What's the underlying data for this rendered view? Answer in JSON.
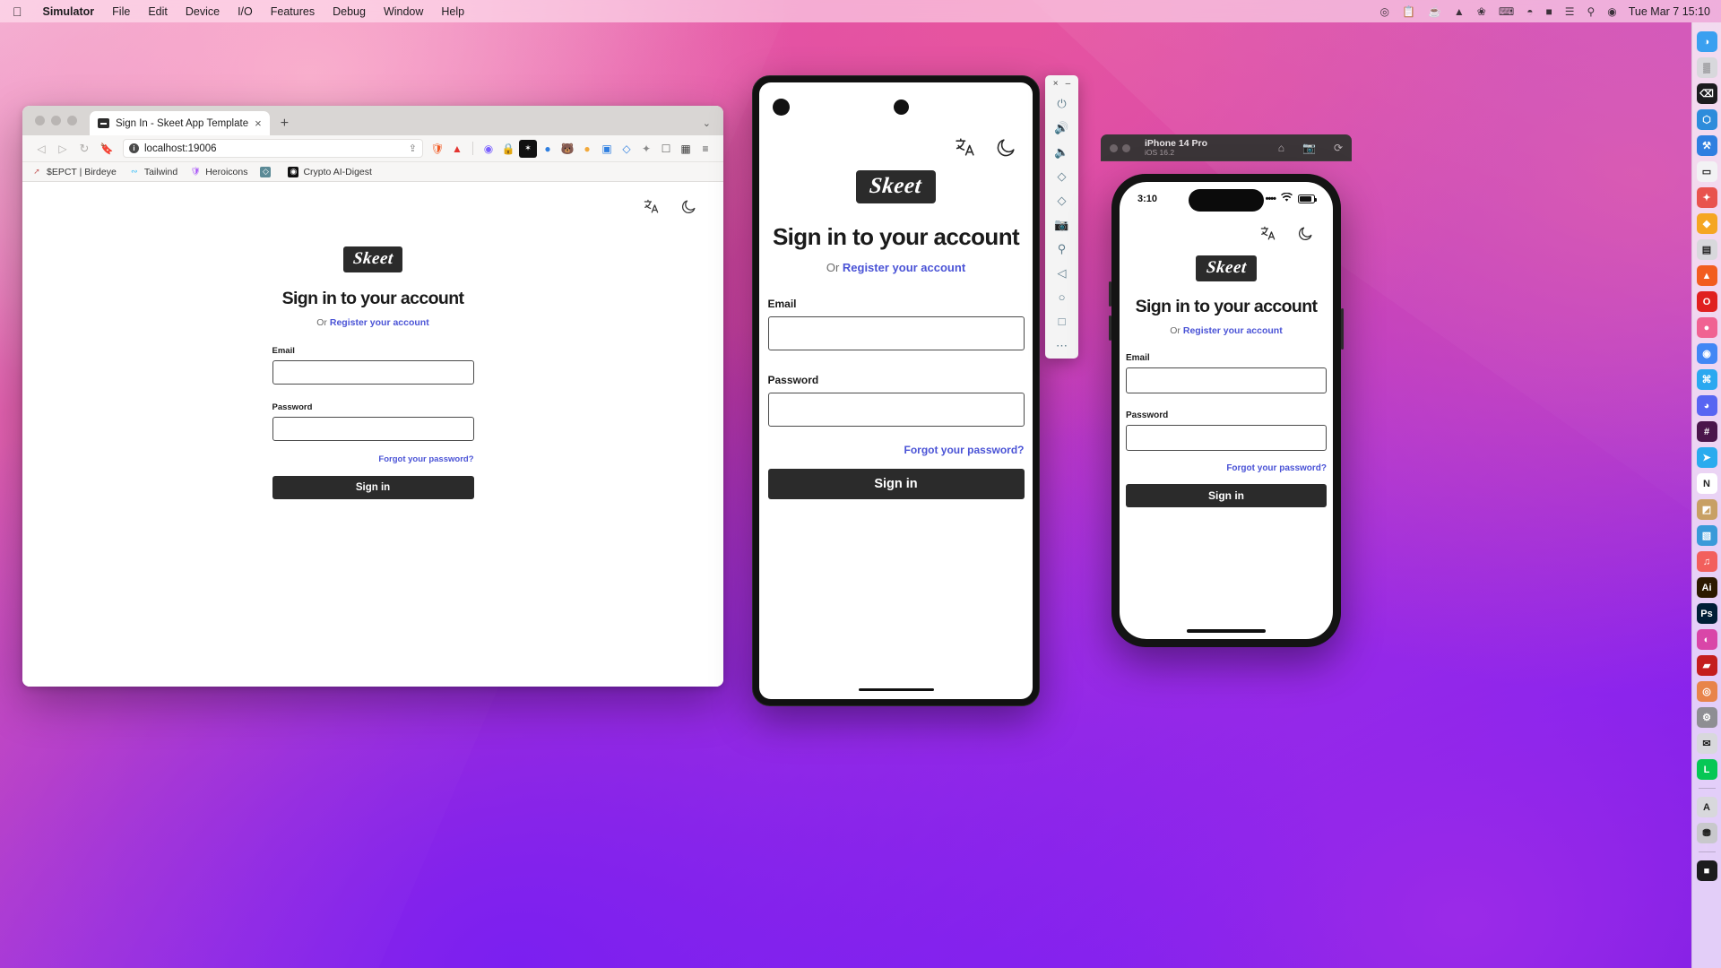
{
  "menubar": {
    "apple_icon": "apple-logo",
    "items": [
      {
        "label": "Simulator",
        "bold": true
      },
      {
        "label": "File",
        "bold": false
      },
      {
        "label": "Edit",
        "bold": false
      },
      {
        "label": "Device",
        "bold": false
      },
      {
        "label": "I/O",
        "bold": false
      },
      {
        "label": "Features",
        "bold": false
      },
      {
        "label": "Debug",
        "bold": false
      },
      {
        "label": "Window",
        "bold": false
      },
      {
        "label": "Help",
        "bold": false
      }
    ],
    "status_icons": [
      "raycast-icon",
      "clipboard-icon",
      "cup-icon",
      "stats-icon",
      "bluetooth-icon",
      "keyboard-icon",
      "wifi-icon",
      "battery-icon",
      "control-center-icon",
      "search-icon",
      "siri-icon"
    ],
    "clock": "Tue Mar 7  15:10"
  },
  "browser": {
    "tab": {
      "title": "Sign In - Skeet App Template",
      "close_label": "×",
      "favicon": "skeet-favicon"
    },
    "new_tab_label": "+",
    "window_chevron": "⌄",
    "nav": {
      "back": "◁",
      "forward": "▷",
      "reload": "↻"
    },
    "bookmark_icon": "bookmark-icon",
    "url": "localhost:19006",
    "url_security_icon": "info-circle-icon",
    "share_icon": "share-icon",
    "toolbar_icons": [
      "brave-shield-icon",
      "adobe-icon",
      "spacer",
      "discord-icon",
      "metamask-lock-icon",
      "phantom-icon",
      "rabby-icon",
      "foxwallet-icon",
      "tally-icon",
      "translate-icon",
      "sketch-icon",
      "extensions-icon",
      "sidebar-icon",
      "wallet-icon",
      "menu-icon"
    ],
    "bookmarks": [
      {
        "label": "$EPCT | Birdeye",
        "icon": "rocket-icon",
        "color": "#c86464"
      },
      {
        "label": "Tailwind",
        "icon": "tailwind-icon",
        "color": "#38bdf8"
      },
      {
        "label": "Heroicons",
        "icon": "heroicons-icon",
        "color": "#a855f7"
      },
      {
        "label": "",
        "icon": "gem-icon",
        "color": "#5b8a96"
      },
      {
        "label": "Crypto AI-Digest",
        "icon": "crypto-icon",
        "color": "#1a1a1a"
      }
    ]
  },
  "app": {
    "logo_text": "Skeet",
    "heading": "Sign in to your account",
    "sub_prefix": "Or ",
    "sub_link": "Register your account",
    "fields": [
      {
        "label": "Email",
        "value": "",
        "name": "email"
      },
      {
        "label": "Password",
        "value": "",
        "name": "password"
      }
    ],
    "forgot_link": "Forgot your password?",
    "submit_label": "Sign in",
    "topbar_icons": [
      {
        "name": "language-icon",
        "glyph": "文A"
      },
      {
        "name": "dark-mode-moon-icon",
        "glyph": "☾"
      }
    ],
    "colors": {
      "link": "#4a53d6",
      "button_bg": "#2b2b2b",
      "logo_bg": "#2b2b2b"
    }
  },
  "android": {
    "window_close": "×",
    "window_minimize": "–",
    "tools": [
      {
        "name": "power-icon",
        "glyph": "⏻"
      },
      {
        "name": "volume-up-icon",
        "glyph": "🔊"
      },
      {
        "name": "volume-down-icon",
        "glyph": "🔉"
      },
      {
        "name": "rotate-left-icon",
        "glyph": "◧"
      },
      {
        "name": "rotate-right-icon",
        "glyph": "◨"
      },
      {
        "name": "screenshot-camera-icon",
        "glyph": "▣"
      },
      {
        "name": "zoom-icon",
        "glyph": "⌕"
      },
      {
        "name": "back-nav-icon",
        "glyph": "◁"
      },
      {
        "name": "home-nav-icon",
        "glyph": "○"
      },
      {
        "name": "recents-nav-icon",
        "glyph": "□"
      },
      {
        "name": "more-options-icon",
        "glyph": "⋯"
      }
    ]
  },
  "ios": {
    "device_name": "iPhone 14 Pro",
    "os_version": "iOS 16.2",
    "titlebar_icons": [
      {
        "name": "home-button-icon",
        "glyph": "⌂"
      },
      {
        "name": "screenshot-icon",
        "glyph": "□"
      },
      {
        "name": "rotate-icon",
        "glyph": "↻"
      }
    ],
    "status": {
      "time": "3:10",
      "cellular": "••••",
      "wifi_icon": "wifi-icon",
      "battery_icon": "battery-icon"
    }
  },
  "dock": {
    "items": [
      {
        "name": "finder",
        "bg": "#3aa0f0",
        "glyph": "◑"
      },
      {
        "name": "launchpad",
        "bg": "#d8d8dc",
        "glyph": "▒"
      },
      {
        "name": "terminal",
        "bg": "#1c1c1e",
        "glyph": "⌫"
      },
      {
        "name": "vscode",
        "bg": "#2d8cdb",
        "glyph": "⬡"
      },
      {
        "name": "xcode",
        "bg": "#2f7fe0",
        "glyph": "⚒"
      },
      {
        "name": "simulator",
        "bg": "#f2f2f4",
        "glyph": "▭"
      },
      {
        "name": "figma",
        "bg": "#e8534e",
        "glyph": "✦"
      },
      {
        "name": "sketch",
        "bg": "#f5a623",
        "glyph": "◆"
      },
      {
        "name": "notion-alt",
        "bg": "#d8d8dc",
        "glyph": "▤"
      },
      {
        "name": "brave",
        "bg": "#f25c1f",
        "glyph": "▲"
      },
      {
        "name": "opera",
        "bg": "#e02020",
        "glyph": "O"
      },
      {
        "name": "arc",
        "bg": "#f06292",
        "glyph": "●"
      },
      {
        "name": "chrome",
        "bg": "#4287f5",
        "glyph": "◉"
      },
      {
        "name": "safari",
        "bg": "#2ba8f0",
        "glyph": "⌘"
      },
      {
        "name": "discord",
        "bg": "#5865f2",
        "glyph": "◕"
      },
      {
        "name": "slack",
        "bg": "#4a154b",
        "glyph": "#"
      },
      {
        "name": "telegram",
        "bg": "#2aabee",
        "glyph": "➤"
      },
      {
        "name": "notion",
        "bg": "#ffffff",
        "glyph": "N"
      },
      {
        "name": "bear",
        "bg": "#c8a064",
        "glyph": "◩"
      },
      {
        "name": "preview",
        "bg": "#3a9ad9",
        "glyph": "▧"
      },
      {
        "name": "music",
        "bg": "#f25f5c",
        "glyph": "♫"
      },
      {
        "name": "illustrator",
        "bg": "#2d1a00",
        "glyph": "Ai"
      },
      {
        "name": "photoshop",
        "bg": "#001e36",
        "glyph": "Ps"
      },
      {
        "name": "lightroom",
        "bg": "#d946a8",
        "glyph": "◐"
      },
      {
        "name": "acrobat",
        "bg": "#c41e1e",
        "glyph": "▰"
      },
      {
        "name": "chatgpt",
        "bg": "#e8844a",
        "glyph": "◎"
      },
      {
        "name": "settings",
        "bg": "#8e8e93",
        "glyph": "⚙"
      },
      {
        "name": "mail",
        "bg": "#d8d8dc",
        "glyph": "✉"
      },
      {
        "name": "line",
        "bg": "#06c755",
        "glyph": "L"
      },
      {
        "name": "appstore",
        "bg": "#d8d8dc",
        "glyph": "A"
      },
      {
        "name": "trash",
        "bg": "#c8c8cc",
        "glyph": "⛃"
      },
      {
        "name": "folder",
        "bg": "#1c1c1e",
        "glyph": "■"
      }
    ]
  }
}
